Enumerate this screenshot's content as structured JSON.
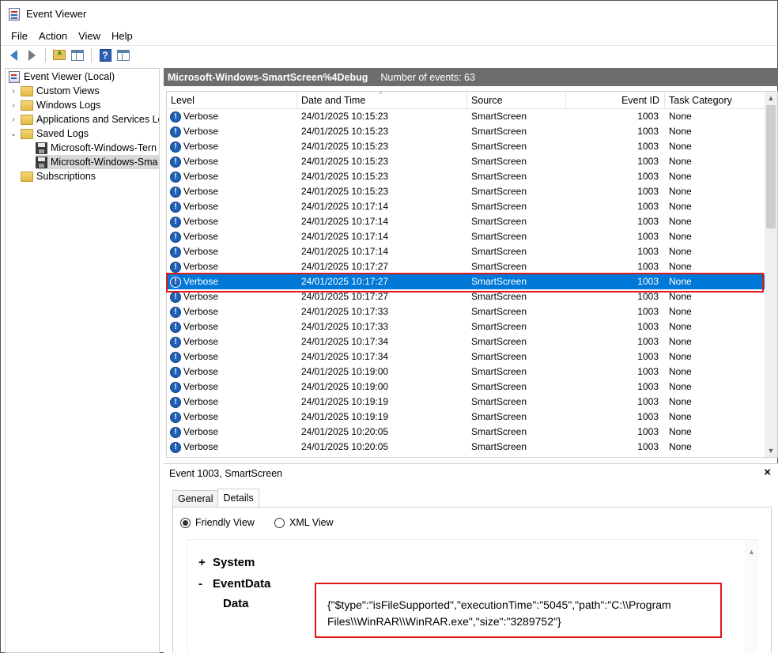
{
  "window": {
    "title": "Event Viewer",
    "icon": "event-viewer-icon"
  },
  "menu": [
    "File",
    "Action",
    "View",
    "Help"
  ],
  "toolbar": {
    "buttons": [
      "back-arrow-icon",
      "forward-arrow-icon",
      "folder-up-icon",
      "show-hide-tree-icon",
      "help-icon",
      "show-hide-action-pane-icon"
    ]
  },
  "tree": {
    "items": [
      {
        "label": "Event Viewer (Local)",
        "icon": "event-viewer-icon",
        "expander": ""
      },
      {
        "label": "Custom Views",
        "icon": "folder-icon",
        "expander": "›"
      },
      {
        "label": "Windows Logs",
        "icon": "folder-icon",
        "expander": "›"
      },
      {
        "label": "Applications and Services Lo",
        "icon": "folder-icon",
        "expander": "›"
      },
      {
        "label": "Saved Logs",
        "icon": "folder-icon",
        "expander": "⌄"
      },
      {
        "label": "Microsoft-Windows-Tern",
        "icon": "saved-log-icon",
        "expander": ""
      },
      {
        "label": "Microsoft-Windows-Sma",
        "icon": "saved-log-icon",
        "expander": "",
        "selected": true
      },
      {
        "label": "Subscriptions",
        "icon": "folder-icon",
        "expander": ""
      }
    ]
  },
  "events": {
    "log_name": "Microsoft-Windows-SmartScreen%4Debug",
    "count_text": "Number of events: 63",
    "columns": [
      "Level",
      "Date and Time",
      "Source",
      "Event ID",
      "Task Category"
    ],
    "rows": [
      {
        "level": "Verbose",
        "date": "24/01/2025 10:15:23",
        "source": "SmartScreen",
        "id": "1003",
        "category": "None"
      },
      {
        "level": "Verbose",
        "date": "24/01/2025 10:15:23",
        "source": "SmartScreen",
        "id": "1003",
        "category": "None"
      },
      {
        "level": "Verbose",
        "date": "24/01/2025 10:15:23",
        "source": "SmartScreen",
        "id": "1003",
        "category": "None"
      },
      {
        "level": "Verbose",
        "date": "24/01/2025 10:15:23",
        "source": "SmartScreen",
        "id": "1003",
        "category": "None"
      },
      {
        "level": "Verbose",
        "date": "24/01/2025 10:15:23",
        "source": "SmartScreen",
        "id": "1003",
        "category": "None"
      },
      {
        "level": "Verbose",
        "date": "24/01/2025 10:15:23",
        "source": "SmartScreen",
        "id": "1003",
        "category": "None"
      },
      {
        "level": "Verbose",
        "date": "24/01/2025 10:17:14",
        "source": "SmartScreen",
        "id": "1003",
        "category": "None"
      },
      {
        "level": "Verbose",
        "date": "24/01/2025 10:17:14",
        "source": "SmartScreen",
        "id": "1003",
        "category": "None"
      },
      {
        "level": "Verbose",
        "date": "24/01/2025 10:17:14",
        "source": "SmartScreen",
        "id": "1003",
        "category": "None"
      },
      {
        "level": "Verbose",
        "date": "24/01/2025 10:17:14",
        "source": "SmartScreen",
        "id": "1003",
        "category": "None"
      },
      {
        "level": "Verbose",
        "date": "24/01/2025 10:17:27",
        "source": "SmartScreen",
        "id": "1003",
        "category": "None"
      },
      {
        "level": "Verbose",
        "date": "24/01/2025 10:17:27",
        "source": "SmartScreen",
        "id": "1003",
        "category": "None",
        "selected": true
      },
      {
        "level": "Verbose",
        "date": "24/01/2025 10:17:27",
        "source": "SmartScreen",
        "id": "1003",
        "category": "None"
      },
      {
        "level": "Verbose",
        "date": "24/01/2025 10:17:33",
        "source": "SmartScreen",
        "id": "1003",
        "category": "None"
      },
      {
        "level": "Verbose",
        "date": "24/01/2025 10:17:33",
        "source": "SmartScreen",
        "id": "1003",
        "category": "None"
      },
      {
        "level": "Verbose",
        "date": "24/01/2025 10:17:34",
        "source": "SmartScreen",
        "id": "1003",
        "category": "None"
      },
      {
        "level": "Verbose",
        "date": "24/01/2025 10:17:34",
        "source": "SmartScreen",
        "id": "1003",
        "category": "None"
      },
      {
        "level": "Verbose",
        "date": "24/01/2025 10:19:00",
        "source": "SmartScreen",
        "id": "1003",
        "category": "None"
      },
      {
        "level": "Verbose",
        "date": "24/01/2025 10:19:00",
        "source": "SmartScreen",
        "id": "1003",
        "category": "None"
      },
      {
        "level": "Verbose",
        "date": "24/01/2025 10:19:19",
        "source": "SmartScreen",
        "id": "1003",
        "category": "None"
      },
      {
        "level": "Verbose",
        "date": "24/01/2025 10:19:19",
        "source": "SmartScreen",
        "id": "1003",
        "category": "None"
      },
      {
        "level": "Verbose",
        "date": "24/01/2025 10:20:05",
        "source": "SmartScreen",
        "id": "1003",
        "category": "None"
      },
      {
        "level": "Verbose",
        "date": "24/01/2025 10:20:05",
        "source": "SmartScreen",
        "id": "1003",
        "category": "None"
      }
    ]
  },
  "details": {
    "title": "Event 1003, SmartScreen",
    "close_label": "×",
    "tabs": [
      {
        "label": "General",
        "active": false
      },
      {
        "label": "Details",
        "active": true
      }
    ],
    "view_options": [
      {
        "label": "Friendly View",
        "checked": true
      },
      {
        "label": "XML View",
        "checked": false
      }
    ],
    "system_toggle": "+",
    "system_label": "System",
    "eventdata_toggle": "-",
    "eventdata_label": "EventData",
    "data_label": "Data",
    "data_value": "{\"$type\":\"isFileSupported\",\"executionTime\":\"5045\",\"path\":\"C:\\\\Program Files\\\\WinRAR\\\\WinRAR.exe\",\"size\":\"3289752\"}"
  },
  "colors": {
    "selection": "#0078d7",
    "highlight": "#e01818",
    "pane_header": "#6d6d6d",
    "info_icon": "#1f5fb6"
  }
}
